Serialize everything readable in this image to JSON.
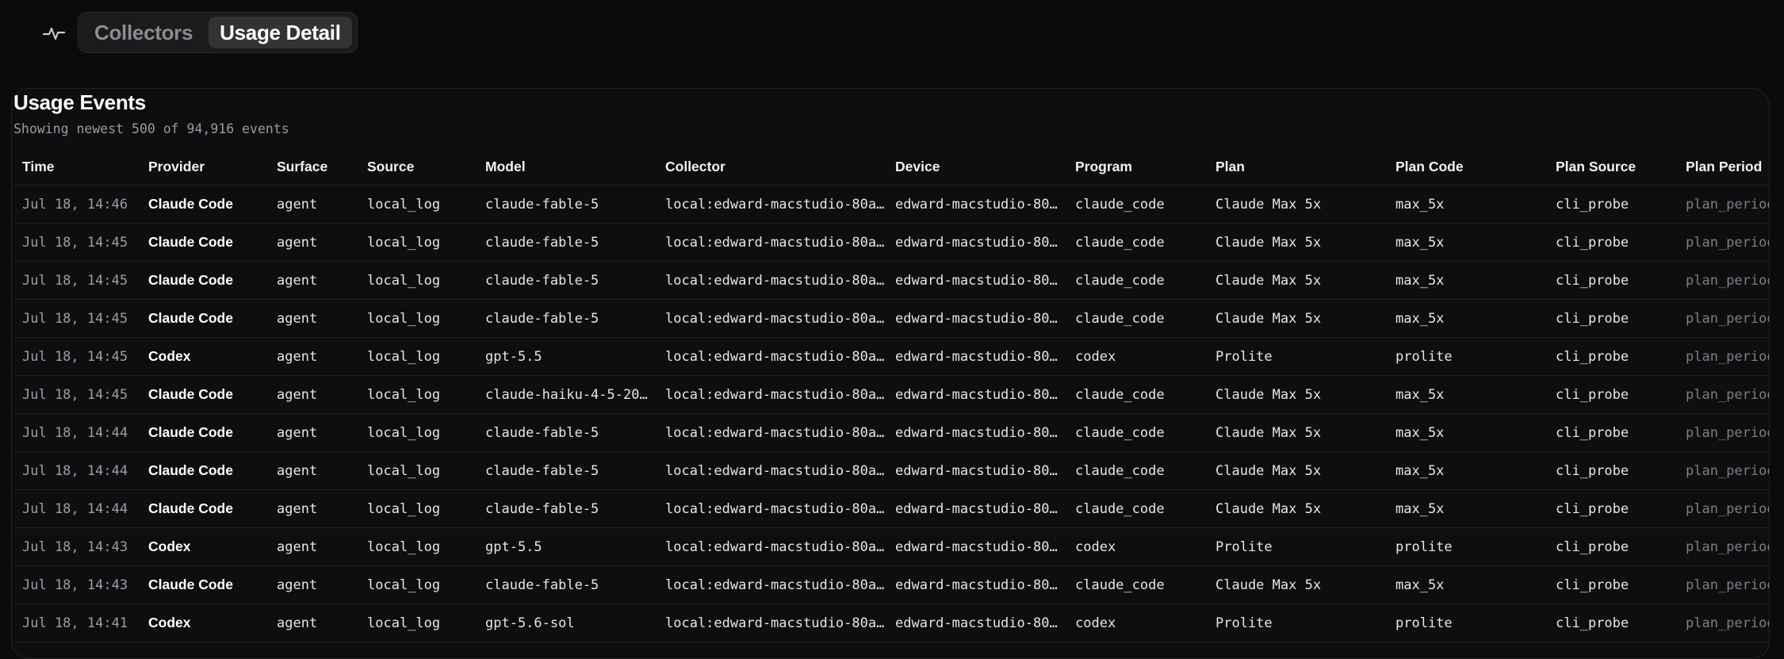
{
  "nav": {
    "icon": "activity-pulse-icon",
    "tabs": [
      {
        "label": "Collectors",
        "active": false
      },
      {
        "label": "Usage Detail",
        "active": true
      }
    ]
  },
  "panel": {
    "title": "Usage Events",
    "subtitle": "Showing newest 500 of 94,916 events"
  },
  "table": {
    "columns": [
      "Time",
      "Provider",
      "Surface",
      "Source",
      "Model",
      "Collector",
      "Device",
      "Program",
      "Plan",
      "Plan Code",
      "Plan Source",
      "Plan Period"
    ],
    "rows": [
      [
        "Jul 18, 14:46",
        "Claude Code",
        "agent",
        "local_log",
        "claude-fable-5",
        "local:edward-macstudio-80a…",
        "edward-macstudio-80…",
        "claude_code",
        "Claude Max 5x",
        "max_5x",
        "cli_probe",
        "plan_period"
      ],
      [
        "Jul 18, 14:45",
        "Claude Code",
        "agent",
        "local_log",
        "claude-fable-5",
        "local:edward-macstudio-80a…",
        "edward-macstudio-80…",
        "claude_code",
        "Claude Max 5x",
        "max_5x",
        "cli_probe",
        "plan_period"
      ],
      [
        "Jul 18, 14:45",
        "Claude Code",
        "agent",
        "local_log",
        "claude-fable-5",
        "local:edward-macstudio-80a…",
        "edward-macstudio-80…",
        "claude_code",
        "Claude Max 5x",
        "max_5x",
        "cli_probe",
        "plan_period"
      ],
      [
        "Jul 18, 14:45",
        "Claude Code",
        "agent",
        "local_log",
        "claude-fable-5",
        "local:edward-macstudio-80a…",
        "edward-macstudio-80…",
        "claude_code",
        "Claude Max 5x",
        "max_5x",
        "cli_probe",
        "plan_period"
      ],
      [
        "Jul 18, 14:45",
        "Codex",
        "agent",
        "local_log",
        "gpt-5.5",
        "local:edward-macstudio-80a…",
        "edward-macstudio-80…",
        "codex",
        "Prolite",
        "prolite",
        "cli_probe",
        "plan_period"
      ],
      [
        "Jul 18, 14:45",
        "Claude Code",
        "agent",
        "local_log",
        "claude-haiku-4-5-20…",
        "local:edward-macstudio-80a…",
        "edward-macstudio-80…",
        "claude_code",
        "Claude Max 5x",
        "max_5x",
        "cli_probe",
        "plan_period"
      ],
      [
        "Jul 18, 14:44",
        "Claude Code",
        "agent",
        "local_log",
        "claude-fable-5",
        "local:edward-macstudio-80a…",
        "edward-macstudio-80…",
        "claude_code",
        "Claude Max 5x",
        "max_5x",
        "cli_probe",
        "plan_period"
      ],
      [
        "Jul 18, 14:44",
        "Claude Code",
        "agent",
        "local_log",
        "claude-fable-5",
        "local:edward-macstudio-80a…",
        "edward-macstudio-80…",
        "claude_code",
        "Claude Max 5x",
        "max_5x",
        "cli_probe",
        "plan_period"
      ],
      [
        "Jul 18, 14:44",
        "Claude Code",
        "agent",
        "local_log",
        "claude-fable-5",
        "local:edward-macstudio-80a…",
        "edward-macstudio-80…",
        "claude_code",
        "Claude Max 5x",
        "max_5x",
        "cli_probe",
        "plan_period"
      ],
      [
        "Jul 18, 14:43",
        "Codex",
        "agent",
        "local_log",
        "gpt-5.5",
        "local:edward-macstudio-80a…",
        "edward-macstudio-80…",
        "codex",
        "Prolite",
        "prolite",
        "cli_probe",
        "plan_period"
      ],
      [
        "Jul 18, 14:43",
        "Claude Code",
        "agent",
        "local_log",
        "claude-fable-5",
        "local:edward-macstudio-80a…",
        "edward-macstudio-80…",
        "claude_code",
        "Claude Max 5x",
        "max_5x",
        "cli_probe",
        "plan_period"
      ],
      [
        "Jul 18, 14:41",
        "Codex",
        "agent",
        "local_log",
        "gpt-5.6-sol",
        "local:edward-macstudio-80a…",
        "edward-macstudio-80…",
        "codex",
        "Prolite",
        "prolite",
        "cli_probe",
        "plan_period"
      ]
    ]
  }
}
